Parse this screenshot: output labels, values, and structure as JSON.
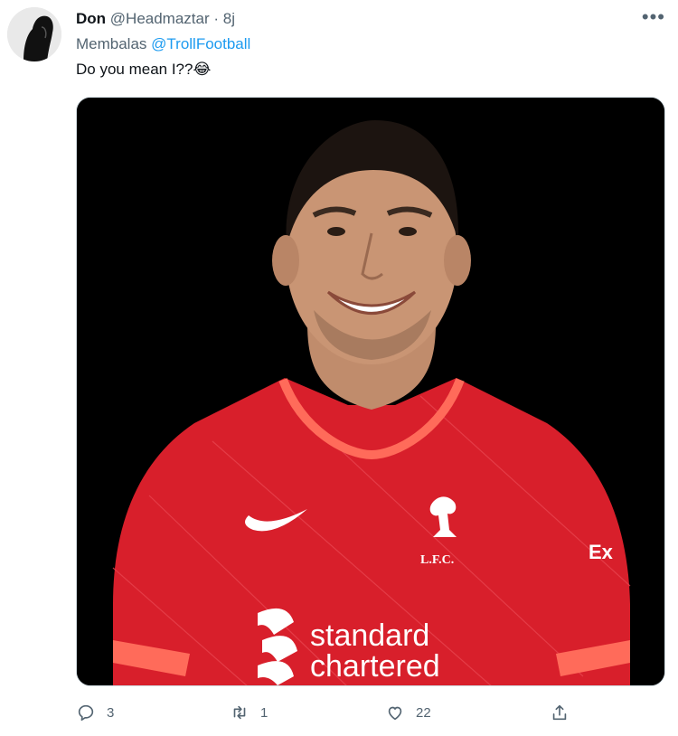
{
  "tweet": {
    "author_name": "Don",
    "author_handle": "@Headmaztar",
    "separator": "·",
    "time": "8j",
    "reply_prefix": "Membalas",
    "reply_to": "@TrollFootball",
    "text": "Do you mean I??",
    "emoji": "😂",
    "avatar_icon": "avatar-face-icon",
    "more_icon": "ellipsis-icon",
    "media_logo_text": "L.F.C.",
    "media_sponsor_line1": "standard",
    "media_sponsor_line2": "chartered",
    "media_sleeve_text": "Ex"
  },
  "actions": {
    "reply_count": "3",
    "retweet_count": "1",
    "like_count": "22"
  },
  "colors": {
    "accent": "#1d9bf0",
    "muted": "#536471",
    "jersey": "#d81f2b"
  }
}
